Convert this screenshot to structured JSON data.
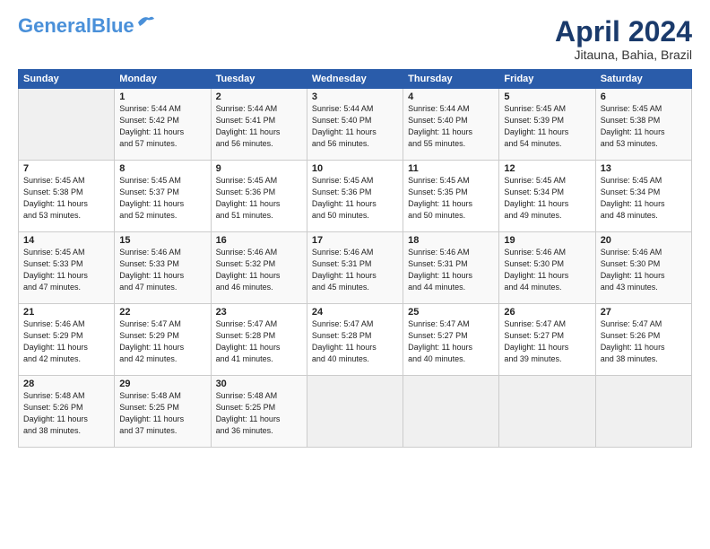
{
  "logo": {
    "line1": "General",
    "line2": "Blue"
  },
  "title": "April 2024",
  "subtitle": "Jitauna, Bahia, Brazil",
  "header_days": [
    "Sunday",
    "Monday",
    "Tuesday",
    "Wednesday",
    "Thursday",
    "Friday",
    "Saturday"
  ],
  "weeks": [
    [
      {
        "day": "",
        "info": ""
      },
      {
        "day": "1",
        "info": "Sunrise: 5:44 AM\nSunset: 5:42 PM\nDaylight: 11 hours\nand 57 minutes."
      },
      {
        "day": "2",
        "info": "Sunrise: 5:44 AM\nSunset: 5:41 PM\nDaylight: 11 hours\nand 56 minutes."
      },
      {
        "day": "3",
        "info": "Sunrise: 5:44 AM\nSunset: 5:40 PM\nDaylight: 11 hours\nand 56 minutes."
      },
      {
        "day": "4",
        "info": "Sunrise: 5:44 AM\nSunset: 5:40 PM\nDaylight: 11 hours\nand 55 minutes."
      },
      {
        "day": "5",
        "info": "Sunrise: 5:45 AM\nSunset: 5:39 PM\nDaylight: 11 hours\nand 54 minutes."
      },
      {
        "day": "6",
        "info": "Sunrise: 5:45 AM\nSunset: 5:38 PM\nDaylight: 11 hours\nand 53 minutes."
      }
    ],
    [
      {
        "day": "7",
        "info": "Sunrise: 5:45 AM\nSunset: 5:38 PM\nDaylight: 11 hours\nand 53 minutes."
      },
      {
        "day": "8",
        "info": "Sunrise: 5:45 AM\nSunset: 5:37 PM\nDaylight: 11 hours\nand 52 minutes."
      },
      {
        "day": "9",
        "info": "Sunrise: 5:45 AM\nSunset: 5:36 PM\nDaylight: 11 hours\nand 51 minutes."
      },
      {
        "day": "10",
        "info": "Sunrise: 5:45 AM\nSunset: 5:36 PM\nDaylight: 11 hours\nand 50 minutes."
      },
      {
        "day": "11",
        "info": "Sunrise: 5:45 AM\nSunset: 5:35 PM\nDaylight: 11 hours\nand 50 minutes."
      },
      {
        "day": "12",
        "info": "Sunrise: 5:45 AM\nSunset: 5:34 PM\nDaylight: 11 hours\nand 49 minutes."
      },
      {
        "day": "13",
        "info": "Sunrise: 5:45 AM\nSunset: 5:34 PM\nDaylight: 11 hours\nand 48 minutes."
      }
    ],
    [
      {
        "day": "14",
        "info": "Sunrise: 5:45 AM\nSunset: 5:33 PM\nDaylight: 11 hours\nand 47 minutes."
      },
      {
        "day": "15",
        "info": "Sunrise: 5:46 AM\nSunset: 5:33 PM\nDaylight: 11 hours\nand 47 minutes."
      },
      {
        "day": "16",
        "info": "Sunrise: 5:46 AM\nSunset: 5:32 PM\nDaylight: 11 hours\nand 46 minutes."
      },
      {
        "day": "17",
        "info": "Sunrise: 5:46 AM\nSunset: 5:31 PM\nDaylight: 11 hours\nand 45 minutes."
      },
      {
        "day": "18",
        "info": "Sunrise: 5:46 AM\nSunset: 5:31 PM\nDaylight: 11 hours\nand 44 minutes."
      },
      {
        "day": "19",
        "info": "Sunrise: 5:46 AM\nSunset: 5:30 PM\nDaylight: 11 hours\nand 44 minutes."
      },
      {
        "day": "20",
        "info": "Sunrise: 5:46 AM\nSunset: 5:30 PM\nDaylight: 11 hours\nand 43 minutes."
      }
    ],
    [
      {
        "day": "21",
        "info": "Sunrise: 5:46 AM\nSunset: 5:29 PM\nDaylight: 11 hours\nand 42 minutes."
      },
      {
        "day": "22",
        "info": "Sunrise: 5:47 AM\nSunset: 5:29 PM\nDaylight: 11 hours\nand 42 minutes."
      },
      {
        "day": "23",
        "info": "Sunrise: 5:47 AM\nSunset: 5:28 PM\nDaylight: 11 hours\nand 41 minutes."
      },
      {
        "day": "24",
        "info": "Sunrise: 5:47 AM\nSunset: 5:28 PM\nDaylight: 11 hours\nand 40 minutes."
      },
      {
        "day": "25",
        "info": "Sunrise: 5:47 AM\nSunset: 5:27 PM\nDaylight: 11 hours\nand 40 minutes."
      },
      {
        "day": "26",
        "info": "Sunrise: 5:47 AM\nSunset: 5:27 PM\nDaylight: 11 hours\nand 39 minutes."
      },
      {
        "day": "27",
        "info": "Sunrise: 5:47 AM\nSunset: 5:26 PM\nDaylight: 11 hours\nand 38 minutes."
      }
    ],
    [
      {
        "day": "28",
        "info": "Sunrise: 5:48 AM\nSunset: 5:26 PM\nDaylight: 11 hours\nand 38 minutes."
      },
      {
        "day": "29",
        "info": "Sunrise: 5:48 AM\nSunset: 5:25 PM\nDaylight: 11 hours\nand 37 minutes."
      },
      {
        "day": "30",
        "info": "Sunrise: 5:48 AM\nSunset: 5:25 PM\nDaylight: 11 hours\nand 36 minutes."
      },
      {
        "day": "",
        "info": ""
      },
      {
        "day": "",
        "info": ""
      },
      {
        "day": "",
        "info": ""
      },
      {
        "day": "",
        "info": ""
      }
    ]
  ]
}
